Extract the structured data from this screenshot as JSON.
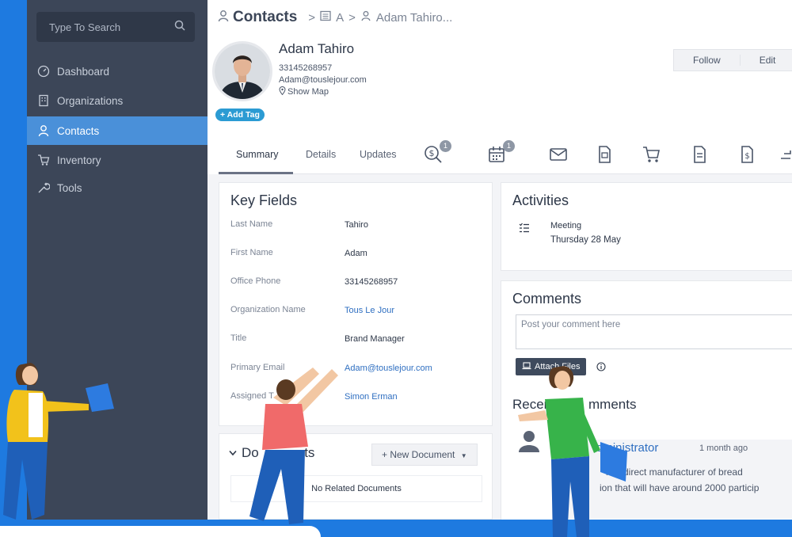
{
  "search": {
    "placeholder": "Type To Search"
  },
  "sidebar": {
    "items": [
      {
        "label": "Dashboard",
        "icon": "dashboard-icon"
      },
      {
        "label": "Organizations",
        "icon": "building-icon"
      },
      {
        "label": "Contacts",
        "icon": "user-icon",
        "active": true
      },
      {
        "label": "Inventory",
        "icon": "inventory-icon"
      },
      {
        "label": "Tools",
        "icon": "wrench-icon"
      }
    ]
  },
  "breadcrumb": {
    "module": "Contacts",
    "letter": "A",
    "record": "Adam Tahiro..."
  },
  "contact": {
    "name": "Adam Tahiro",
    "phone": "33145268957",
    "email": "Adam@touslejour.com",
    "show_map": "Show Map",
    "add_tag": "+ Add Tag"
  },
  "header_actions": {
    "follow": "Follow",
    "edit": "Edit"
  },
  "tabs": {
    "summary": "Summary",
    "details": "Details",
    "updates": "Updates",
    "deals_badge": "1",
    "calendar_badge": "1"
  },
  "key_fields": {
    "title": "Key Fields",
    "rows": [
      {
        "label": "Last Name",
        "value": "Tahiro"
      },
      {
        "label": "First Name",
        "value": "Adam"
      },
      {
        "label": "Office Phone",
        "value": "33145268957"
      },
      {
        "label": "Organization Name",
        "value": "Tous Le Jour"
      },
      {
        "label": "Title",
        "value": "Brand Manager"
      },
      {
        "label": "Primary Email",
        "value": "Adam@touslejour.com"
      },
      {
        "label": "Assigned T",
        "value": "Simon Erman"
      }
    ]
  },
  "documents": {
    "title_start": "Do",
    "title_end": "nts",
    "new_document": "+ New Document",
    "empty": "No Related Documents"
  },
  "activities": {
    "title": "Activities",
    "item_type": "Meeting",
    "item_date": "Thursday 28 May"
  },
  "comments": {
    "title": "Comments",
    "placeholder": "Post your comment here",
    "attach": "Attach Files",
    "recent_start": "Recen",
    "recent_end": "mments",
    "author": "dministrator",
    "time": "1 month ago",
    "text_line1": "is a direct manufacturer of bread",
    "text_line2": "ion that will have around 2000 particip"
  }
}
